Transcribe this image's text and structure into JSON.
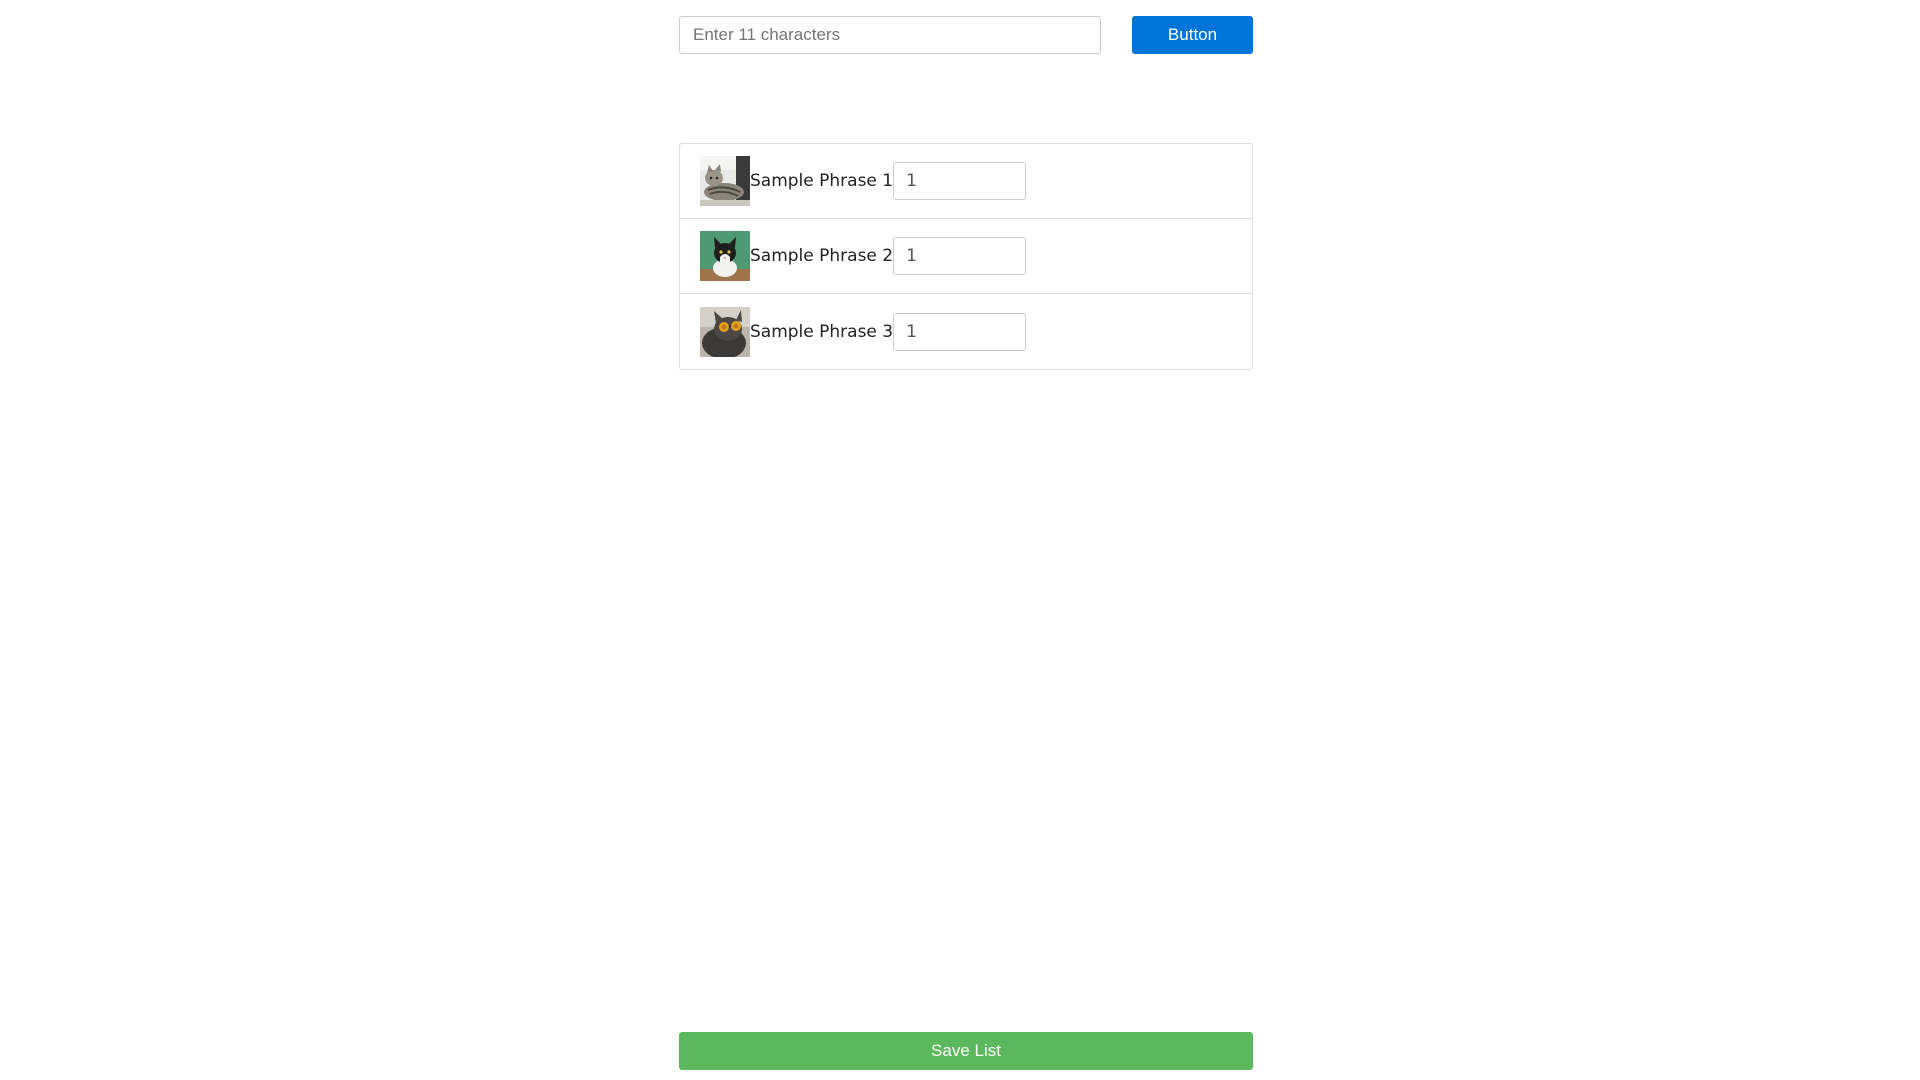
{
  "search": {
    "placeholder": "Enter 11 characters",
    "value": ""
  },
  "toolbar": {
    "button_label": "Button",
    "button_color": "#0074d9"
  },
  "list": {
    "items": [
      {
        "thumbnail": "tabby-cat-lying-image",
        "label": "Sample Phrase 1",
        "quantity": "1"
      },
      {
        "thumbnail": "black-white-cat-green-background-image",
        "label": "Sample Phrase 2",
        "quantity": "1"
      },
      {
        "thumbnail": "cat-with-sunglasses-image",
        "label": "Sample Phrase 3",
        "quantity": "1"
      }
    ]
  },
  "footer": {
    "save_label": "Save List",
    "save_color": "#5cb85c"
  }
}
